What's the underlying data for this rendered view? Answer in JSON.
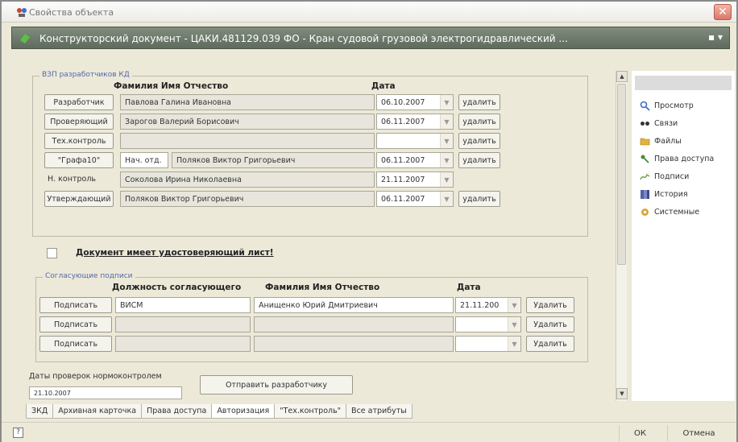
{
  "window": {
    "title": "Свойства объекта",
    "close_glyph": "✕"
  },
  "object_bar": {
    "title": "Конструкторский документ - ЦАКИ.481129.039 ФО - Кран судовой грузовой электрогидравлический ...",
    "menu_glyph": "▪ ▾"
  },
  "developers": {
    "group_label": "ВЗП разработчиков КД",
    "col_name": "Фамилия Имя Отчество",
    "col_date": "Дата",
    "rows": [
      {
        "role": "Разработчик",
        "role_is_button": true,
        "name": "Павлова Галина Ивановна",
        "date": "06.10.2007",
        "delete": "удалить"
      },
      {
        "role": "Проверяющий",
        "role_is_button": true,
        "name": "Зарогов Валерий Борисович",
        "date": "06.11.2007",
        "delete": "удалить"
      },
      {
        "role": "Тех.контроль",
        "role_is_button": true,
        "name": "",
        "date": "",
        "delete": "удалить"
      },
      {
        "role": "\"Графа10\"",
        "role_is_button": true,
        "prefix": "Нач. отд.",
        "name": "Поляков Виктор Григорьевич",
        "date": "06.11.2007",
        "delete": "удалить"
      },
      {
        "role": "Н. контроль",
        "role_is_button": false,
        "name": "Соколова Ирина Николаевна",
        "date": "21.11.2007",
        "delete": ""
      },
      {
        "role": "Утверждающий",
        "role_is_button": true,
        "name": "Поляков Виктор Григорьевич",
        "date": "06.11.2007",
        "delete": "удалить"
      }
    ],
    "certificate_note": "Документ имеет удостоверяющий лист!"
  },
  "approvals": {
    "group_label": "Согласующие подписи",
    "col_position": "Должность согласующего",
    "col_name": "Фамилия Имя Отчество",
    "col_date": "Дата",
    "rows": [
      {
        "sign": "Подписать",
        "position": "ВИСМ",
        "name": "Анищенко Юрий Дмитриевич",
        "date": "21.11.200",
        "delete": "Удалить"
      },
      {
        "sign": "Подписать",
        "position": "",
        "name": "",
        "date": "",
        "delete": "Удалить"
      },
      {
        "sign": "Подписать",
        "position": "",
        "name": "",
        "date": "",
        "delete": "Удалить"
      }
    ]
  },
  "norm_control": {
    "dates_label": "Даты проверок нормоконтролем",
    "dates_value": "21.10.2007",
    "send_button": "Отправить разработчику"
  },
  "side_panel": {
    "items": [
      {
        "label": "Просмотр",
        "icon": "magnifier-icon",
        "color": "#3a6fc4"
      },
      {
        "label": "Связи",
        "icon": "links-icon",
        "color": "#333333"
      },
      {
        "label": "Файлы",
        "icon": "folder-icon",
        "color": "#e0b43a"
      },
      {
        "label": "Права доступа",
        "icon": "key-icon",
        "color": "#4a8a3a"
      },
      {
        "label": "Подписи",
        "icon": "signature-icon",
        "color": "#7fa35a"
      },
      {
        "label": "История",
        "icon": "history-icon",
        "color": "#5060a8"
      },
      {
        "label": "Системные",
        "icon": "gear-icon",
        "color": "#d8a43a"
      }
    ]
  },
  "tabs": [
    {
      "label": "ЗКД",
      "active": false
    },
    {
      "label": "Архивная карточка",
      "active": false
    },
    {
      "label": "Права доступа",
      "active": false
    },
    {
      "label": "Авторизация",
      "active": true
    },
    {
      "label": "\"Тех.контроль\"",
      "active": false
    },
    {
      "label": "Все атрибуты",
      "active": false
    }
  ],
  "footer": {
    "help_glyph": "?",
    "ok": "ОК",
    "cancel": "Отмена"
  }
}
